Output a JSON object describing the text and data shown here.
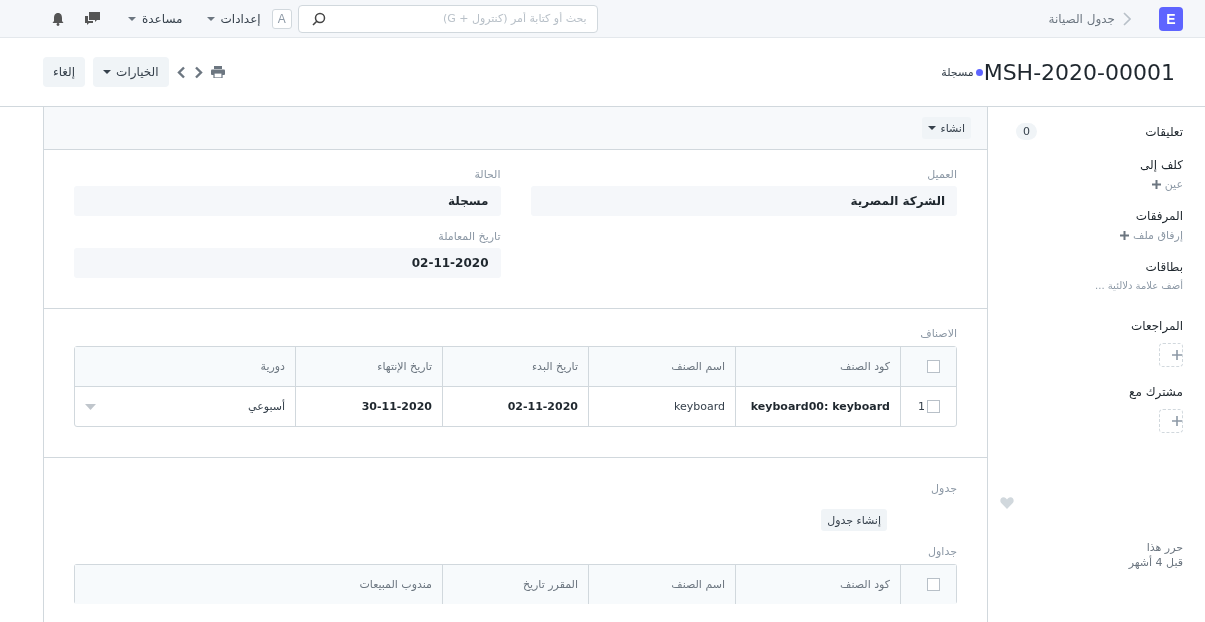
{
  "navbar": {
    "logo": "E",
    "breadcrumb": "جدول الصيانة",
    "search": {
      "placeholder": "بحث أو كتابة أمر (كنترول + G)"
    },
    "avatar": "A",
    "menus": [
      {
        "label": "إعدادات"
      },
      {
        "label": "مساعدة"
      }
    ]
  },
  "page_head": {
    "title": "MSH-2020-00001",
    "status": "مسجلة",
    "actions": [
      {
        "label": "الخيارات",
        "kind": "dropdown"
      },
      {
        "label": "إلغاء",
        "kind": "plain"
      }
    ]
  },
  "sidebar": {
    "comments": {
      "label": "تعليقات",
      "count": "0"
    },
    "sections": [
      {
        "title": "كلف إلى",
        "kind": "link",
        "action": "عين"
      },
      {
        "title": "المرفقات",
        "kind": "link",
        "action": "إرفاق ملف"
      },
      {
        "title": "بطاقات",
        "kind": "hint",
        "action": "أضف علامة دلالئية ..."
      },
      {
        "title": "المراجعات",
        "kind": "add_box"
      },
      {
        "title": "مشترك مع",
        "kind": "add_box"
      }
    ],
    "activity": [
      "حرر هذا",
      "قبل 4 أشهر"
    ]
  },
  "form": {
    "toolbar_button": "انشاء",
    "field_columns": [
      [
        {
          "label": "العميل",
          "value": "الشركة المصرية"
        }
      ],
      [
        {
          "label": "الحالة",
          "value": "مسجلة"
        },
        {
          "label": "تاريخ المعاملة",
          "value": "02-11-2020"
        }
      ]
    ],
    "items": {
      "label": "الاصناف",
      "all_checked": false,
      "columns": [
        "كود الصنف",
        "اسم الصنف",
        "تاريخ البدء",
        "تاريخ الإنتهاء",
        "دورية"
      ],
      "rows": [
        {
          "index": "1",
          "checked": false,
          "cells": [
            {
              "text": "keyboard00: keyboard",
              "bold": true
            },
            {
              "text": "keyboard",
              "bold": false
            },
            {
              "text": "02-11-2020",
              "bold": true
            },
            {
              "text": "30-11-2020",
              "bold": true
            },
            {
              "text": "أسبوعي",
              "bold": false
            }
          ]
        }
      ]
    },
    "schedule": {
      "label": "جدول",
      "button": "إنشاء جدول",
      "table_label": "جداول",
      "all_checked": false,
      "columns": [
        "كود الصنف",
        "اسم الصنف",
        "المقرر تاريخ",
        "مندوب المبيعات"
      ]
    }
  }
}
